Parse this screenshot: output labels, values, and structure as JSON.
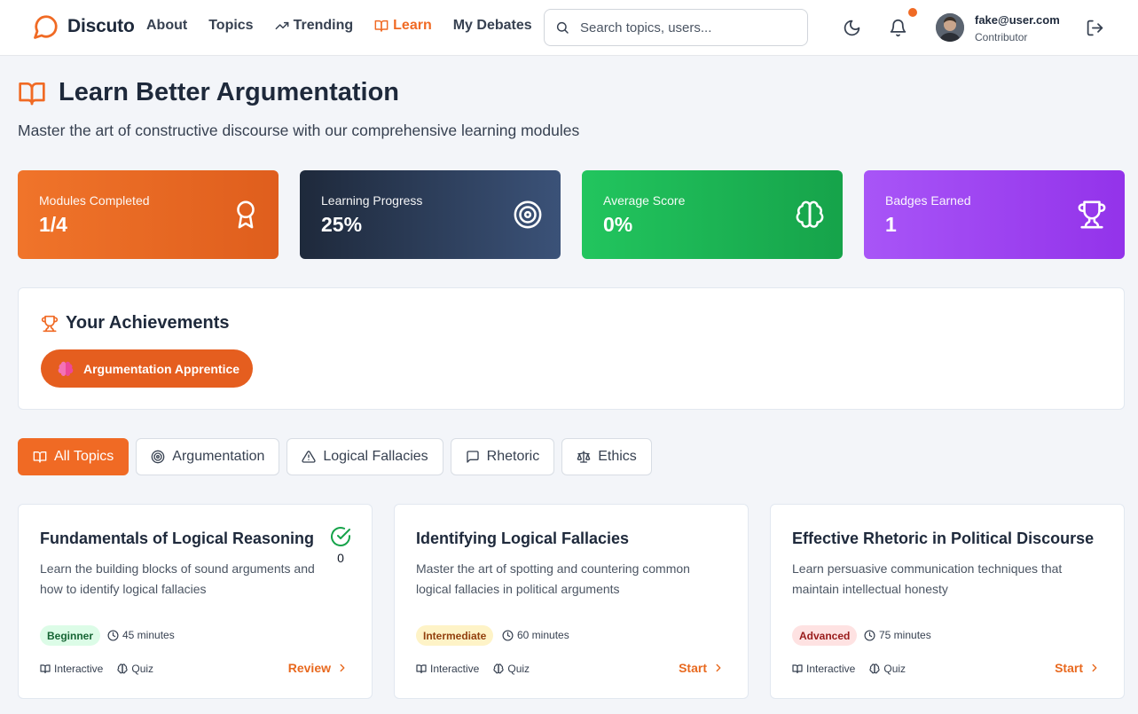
{
  "app": {
    "name": "Discuto"
  },
  "nav": {
    "about": "About",
    "topics": "Topics",
    "trending": "Trending",
    "learn": "Learn",
    "my_debates": "My Debates"
  },
  "search": {
    "placeholder": "Search topics, users..."
  },
  "user": {
    "email": "fake@user.com",
    "role": "Contributor"
  },
  "page": {
    "title": "Learn Better Argumentation",
    "subtitle": "Master the art of constructive discourse with our comprehensive learning modules"
  },
  "stats": [
    {
      "label": "Modules Completed",
      "value": "1/4",
      "icon": "award-icon",
      "colors": [
        "#f0742a",
        "#df5e1d"
      ]
    },
    {
      "label": "Learning Progress",
      "value": "25%",
      "icon": "target-icon",
      "colors": [
        "#1e293b",
        "#3b5278"
      ]
    },
    {
      "label": "Average Score",
      "value": "0%",
      "icon": "brain-icon",
      "colors": [
        "#22c55e",
        "#16a34a"
      ]
    },
    {
      "label": "Badges Earned",
      "value": "1",
      "icon": "trophy-icon",
      "colors": [
        "#a855f7",
        "#9333ea"
      ]
    }
  ],
  "achievements": {
    "title": "Your Achievements",
    "badges": [
      {
        "label": "Argumentation Apprentice",
        "icon": "brain-icon"
      }
    ]
  },
  "filters": [
    {
      "label": "All Topics",
      "icon": "book-icon",
      "active": true
    },
    {
      "label": "Argumentation",
      "icon": "target-icon"
    },
    {
      "label": "Logical Fallacies",
      "icon": "warning-icon"
    },
    {
      "label": "Rhetoric",
      "icon": "message-icon"
    },
    {
      "label": "Ethics",
      "icon": "scale-icon"
    }
  ],
  "modules": [
    {
      "title": "Fundamentals of Logical Reasoning",
      "description": "Learn the building blocks of sound arguments and how to identify logical fallacies",
      "level": "Beginner",
      "duration": "45 minutes",
      "features": [
        "Interactive",
        "Quiz"
      ],
      "action": "Review",
      "completed": true,
      "score": "0"
    },
    {
      "title": "Identifying Logical Fallacies",
      "description": "Master the art of spotting and countering common logical fallacies in political arguments",
      "level": "Intermediate",
      "duration": "60 minutes",
      "features": [
        "Interactive",
        "Quiz"
      ],
      "action": "Start"
    },
    {
      "title": "Effective Rhetoric in Political Discourse",
      "description": "Learn persuasive communication techniques that maintain intellectual honesty",
      "level": "Advanced",
      "duration": "75 minutes",
      "features": [
        "Interactive",
        "Quiz"
      ],
      "action": "Start"
    }
  ],
  "colors": {
    "accent": "#f06a24",
    "text": "#1e293b",
    "success": "#16a34a"
  }
}
